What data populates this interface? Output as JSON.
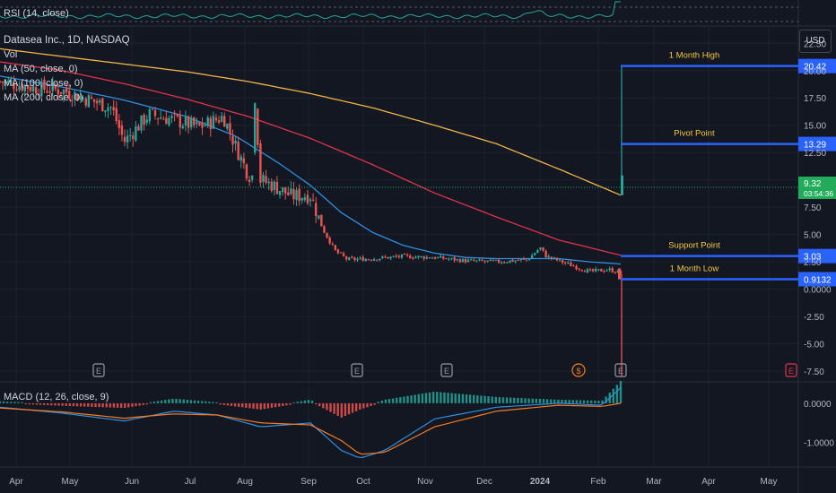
{
  "indicators": {
    "rsi": "RSI (14, close)",
    "symbol": "Datasea Inc., 1D, NASDAQ",
    "vol": "Vol",
    "ma50": "MA (50, close, 0)",
    "ma100": "MA (100, close, 0)",
    "ma200": "MA (200, close, 0)",
    "macd": "MACD (12, 26, close, 9)"
  },
  "currency": "USD",
  "colors": {
    "background": "#131722",
    "up": "#26a69a",
    "down": "#ef5350",
    "ma50": "#2f8fe0",
    "ma100": "#e0344a",
    "ma200": "#f0b548",
    "level_line": "#2962ff",
    "level_text": "#f5c842",
    "rsi": "#26a69a",
    "macd_line": "#2f8fe0",
    "signal_line": "#f57c20",
    "last_price_bg": "#22ab5a"
  },
  "chart_data": {
    "type": "candlestick",
    "price_axis": {
      "ticks": [
        "22.50",
        "20.00",
        "17.50",
        "15.00",
        "12.50",
        "10.00",
        "7.50",
        "5.00",
        "2.50",
        "0.0000",
        "-2.50",
        "-5.00",
        "-7.50"
      ],
      "range": [
        -8.4,
        24.0
      ]
    },
    "time_axis": {
      "ticks": [
        "Apr",
        "May",
        "Jun",
        "Jul",
        "Aug",
        "Sep",
        "Oct",
        "Nov",
        "Dec",
        "2024",
        "Feb",
        "Mar",
        "Apr",
        "May"
      ]
    },
    "levels": [
      {
        "name": "1 Month High",
        "price": 20.42,
        "label": "20.42"
      },
      {
        "name": "Pivot Point",
        "price": 13.29,
        "label": "13.29"
      },
      {
        "name": "Support Point",
        "price": 3.03,
        "label": "3.03"
      },
      {
        "name": "1 Month Low",
        "price": 0.9132,
        "label": "0.9132"
      }
    ],
    "last_price": {
      "price": 9.32,
      "label": "9.32",
      "countdown": "03:54:36"
    },
    "series_anchors": {
      "close": [
        [
          0,
          19.0
        ],
        [
          0.06,
          18.4
        ],
        [
          0.1,
          18.2
        ],
        [
          0.14,
          17.4
        ],
        [
          0.18,
          16.6
        ],
        [
          0.2,
          13.5
        ],
        [
          0.24,
          16.0
        ],
        [
          0.28,
          15.5
        ],
        [
          0.32,
          14.8
        ],
        [
          0.36,
          15.8
        ],
        [
          0.38,
          13.0
        ],
        [
          0.4,
          10.5
        ],
        [
          0.44,
          9.5
        ],
        [
          0.47,
          8.5
        ],
        [
          0.5,
          8.6
        ],
        [
          0.52,
          5.5
        ],
        [
          0.54,
          3.5
        ],
        [
          0.56,
          2.7
        ],
        [
          0.6,
          2.8
        ],
        [
          0.65,
          3.0
        ],
        [
          0.7,
          2.9
        ],
        [
          0.75,
          2.6
        ],
        [
          0.8,
          2.5
        ],
        [
          0.85,
          2.7
        ],
        [
          0.87,
          3.8
        ],
        [
          0.88,
          3.0
        ],
        [
          0.92,
          2.2
        ],
        [
          0.95,
          1.6
        ],
        [
          0.98,
          1.8
        ],
        [
          1.0,
          1.5
        ]
      ],
      "ma50": [
        [
          0,
          19.5
        ],
        [
          0.1,
          18.5
        ],
        [
          0.2,
          17.3
        ],
        [
          0.3,
          15.8
        ],
        [
          0.38,
          14.0
        ],
        [
          0.45,
          11.5
        ],
        [
          0.5,
          9.5
        ],
        [
          0.55,
          7.0
        ],
        [
          0.6,
          5.2
        ],
        [
          0.65,
          4.0
        ],
        [
          0.7,
          3.3
        ],
        [
          0.75,
          2.9
        ],
        [
          0.8,
          2.8
        ],
        [
          0.85,
          2.8
        ],
        [
          0.9,
          2.8
        ],
        [
          0.95,
          2.5
        ],
        [
          1.0,
          2.3
        ]
      ],
      "ma100": [
        [
          0,
          20.8
        ],
        [
          0.1,
          20.0
        ],
        [
          0.2,
          18.8
        ],
        [
          0.3,
          17.4
        ],
        [
          0.4,
          15.8
        ],
        [
          0.5,
          13.8
        ],
        [
          0.6,
          11.4
        ],
        [
          0.7,
          8.8
        ],
        [
          0.8,
          6.6
        ],
        [
          0.9,
          4.5
        ],
        [
          1.0,
          3.1
        ]
      ],
      "ma200": [
        [
          0,
          22.0
        ],
        [
          0.1,
          21.3
        ],
        [
          0.2,
          20.6
        ],
        [
          0.3,
          19.9
        ],
        [
          0.4,
          19.0
        ],
        [
          0.5,
          17.9
        ],
        [
          0.6,
          16.6
        ],
        [
          0.7,
          15.0
        ],
        [
          0.8,
          13.3
        ],
        [
          0.9,
          11.0
        ],
        [
          1.0,
          8.6
        ]
      ],
      "macd": [
        [
          0,
          -0.1
        ],
        [
          0.1,
          -0.25
        ],
        [
          0.2,
          -0.45
        ],
        [
          0.28,
          -0.2
        ],
        [
          0.35,
          -0.3
        ],
        [
          0.42,
          -0.6
        ],
        [
          0.5,
          -0.5
        ],
        [
          0.55,
          -1.2
        ],
        [
          0.58,
          -1.4
        ],
        [
          0.62,
          -1.2
        ],
        [
          0.7,
          -0.4
        ],
        [
          0.8,
          -0.1
        ],
        [
          0.9,
          0.0
        ],
        [
          0.97,
          -0.05
        ],
        [
          1.0,
          0.4
        ]
      ],
      "signal": [
        [
          0,
          -0.12
        ],
        [
          0.1,
          -0.22
        ],
        [
          0.2,
          -0.38
        ],
        [
          0.28,
          -0.27
        ],
        [
          0.35,
          -0.3
        ],
        [
          0.42,
          -0.5
        ],
        [
          0.5,
          -0.55
        ],
        [
          0.55,
          -0.95
        ],
        [
          0.58,
          -1.3
        ],
        [
          0.62,
          -1.25
        ],
        [
          0.7,
          -0.6
        ],
        [
          0.8,
          -0.2
        ],
        [
          0.9,
          -0.05
        ],
        [
          0.97,
          -0.08
        ],
        [
          1.0,
          0.0
        ]
      ]
    },
    "macd_axis": {
      "ticks": [
        "0.0000",
        "-1.0000"
      ],
      "range": [
        -1.6,
        0.5
      ]
    },
    "event_markers": [
      {
        "label": "E",
        "date": "Apr"
      },
      {
        "label": "E",
        "date": "Sep"
      },
      {
        "label": "E",
        "date": "Nov"
      },
      {
        "label": "$",
        "date": "Jan"
      },
      {
        "label": "E",
        "date": "Feb"
      },
      {
        "label": "E",
        "date": "May"
      }
    ]
  }
}
